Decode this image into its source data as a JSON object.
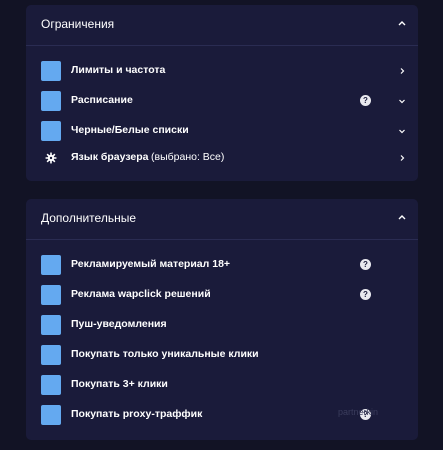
{
  "restrictions": {
    "title": "Ограничения",
    "items": [
      {
        "label": "Лимиты и частота"
      },
      {
        "label": "Расписание",
        "help": "?"
      },
      {
        "label": "Черные/Белые списки"
      },
      {
        "label": "Язык браузера",
        "extra": "(выбрано: Все)"
      }
    ]
  },
  "additional": {
    "title": "Дополнительные",
    "items": [
      {
        "label": "Рекламируемый материал 18+",
        "help": "?"
      },
      {
        "label": "Реклама wapclick решений",
        "help": "?"
      },
      {
        "label": "Пуш-уведомления"
      },
      {
        "label": "Покупать только уникальные клики"
      },
      {
        "label": "Покупать 3+ клики"
      },
      {
        "label": "Покупать proxy-траффик",
        "help": "?"
      }
    ]
  },
  "watermark": "partnerkin",
  "colors": {
    "background": "#121325",
    "panel": "#1a1b3a",
    "checkbox": "#64a9f0",
    "text": "#ffffff"
  }
}
